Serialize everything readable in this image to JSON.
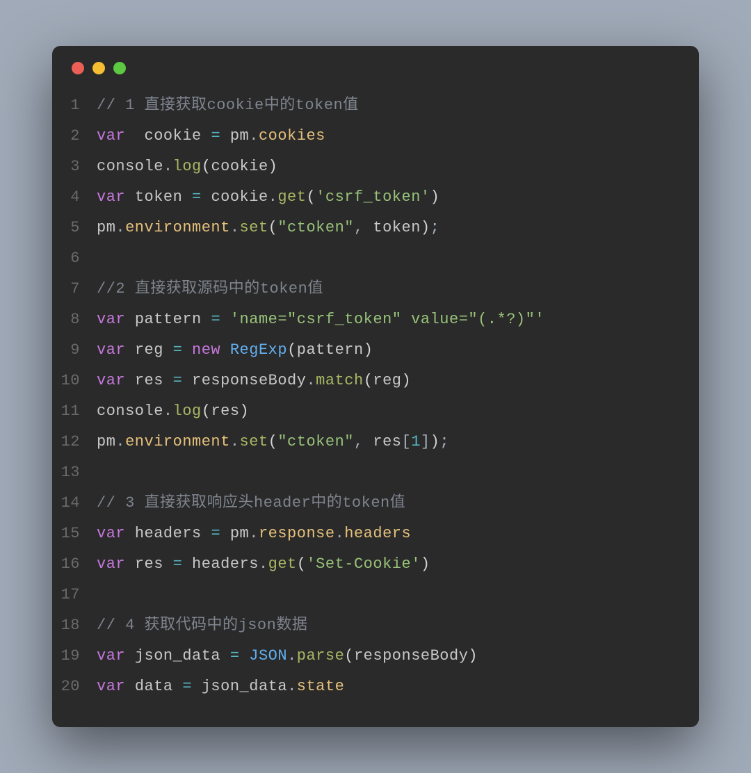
{
  "window": {
    "traffic_lights": {
      "red": "#ec5f56",
      "yellow": "#f5bd31",
      "green": "#5dc942"
    }
  },
  "code": {
    "lines": [
      {
        "n": "1",
        "tokens": [
          {
            "c": "comment",
            "t": "// 1 直接获取cookie中的token值"
          }
        ]
      },
      {
        "n": "2",
        "tokens": [
          {
            "c": "keyword",
            "t": "var"
          },
          {
            "c": "plain",
            "t": "  "
          },
          {
            "c": "ident",
            "t": "cookie"
          },
          {
            "c": "plain",
            "t": " "
          },
          {
            "c": "op",
            "t": "="
          },
          {
            "c": "plain",
            "t": " "
          },
          {
            "c": "ident",
            "t": "pm"
          },
          {
            "c": "punct",
            "t": "."
          },
          {
            "c": "prop",
            "t": "cookies"
          }
        ]
      },
      {
        "n": "3",
        "tokens": [
          {
            "c": "ident",
            "t": "console"
          },
          {
            "c": "punct",
            "t": "."
          },
          {
            "c": "method2",
            "t": "log"
          },
          {
            "c": "paren",
            "t": "("
          },
          {
            "c": "ident",
            "t": "cookie"
          },
          {
            "c": "paren",
            "t": ")"
          }
        ]
      },
      {
        "n": "4",
        "tokens": [
          {
            "c": "keyword",
            "t": "var"
          },
          {
            "c": "plain",
            "t": " "
          },
          {
            "c": "ident",
            "t": "token"
          },
          {
            "c": "plain",
            "t": " "
          },
          {
            "c": "op",
            "t": "="
          },
          {
            "c": "plain",
            "t": " "
          },
          {
            "c": "ident",
            "t": "cookie"
          },
          {
            "c": "punct",
            "t": "."
          },
          {
            "c": "method2",
            "t": "get"
          },
          {
            "c": "paren",
            "t": "("
          },
          {
            "c": "string",
            "t": "'csrf_token'"
          },
          {
            "c": "paren",
            "t": ")"
          }
        ]
      },
      {
        "n": "5",
        "tokens": [
          {
            "c": "ident",
            "t": "pm"
          },
          {
            "c": "punct",
            "t": "."
          },
          {
            "c": "prop",
            "t": "environment"
          },
          {
            "c": "punct",
            "t": "."
          },
          {
            "c": "method2",
            "t": "set"
          },
          {
            "c": "paren",
            "t": "("
          },
          {
            "c": "string",
            "t": "\"ctoken\""
          },
          {
            "c": "punct",
            "t": ", "
          },
          {
            "c": "ident",
            "t": "token"
          },
          {
            "c": "paren",
            "t": ")"
          },
          {
            "c": "punct",
            "t": ";"
          }
        ]
      },
      {
        "n": "6",
        "tokens": [
          {
            "c": "plain",
            "t": ""
          }
        ]
      },
      {
        "n": "7",
        "tokens": [
          {
            "c": "comment",
            "t": "//2 直接获取源码中的token值"
          }
        ]
      },
      {
        "n": "8",
        "tokens": [
          {
            "c": "keyword",
            "t": "var"
          },
          {
            "c": "plain",
            "t": " "
          },
          {
            "c": "ident",
            "t": "pattern"
          },
          {
            "c": "plain",
            "t": " "
          },
          {
            "c": "op",
            "t": "="
          },
          {
            "c": "plain",
            "t": " "
          },
          {
            "c": "string",
            "t": "'name=\"csrf_token\" value=\"(.*?)\"'"
          }
        ]
      },
      {
        "n": "9",
        "tokens": [
          {
            "c": "keyword",
            "t": "var"
          },
          {
            "c": "plain",
            "t": " "
          },
          {
            "c": "ident",
            "t": "reg"
          },
          {
            "c": "plain",
            "t": " "
          },
          {
            "c": "op",
            "t": "="
          },
          {
            "c": "plain",
            "t": " "
          },
          {
            "c": "keyword",
            "t": "new"
          },
          {
            "c": "plain",
            "t": " "
          },
          {
            "c": "type",
            "t": "RegExp"
          },
          {
            "c": "paren",
            "t": "("
          },
          {
            "c": "ident",
            "t": "pattern"
          },
          {
            "c": "paren",
            "t": ")"
          }
        ]
      },
      {
        "n": "10",
        "tokens": [
          {
            "c": "keyword",
            "t": "var"
          },
          {
            "c": "plain",
            "t": " "
          },
          {
            "c": "ident",
            "t": "res"
          },
          {
            "c": "plain",
            "t": " "
          },
          {
            "c": "op",
            "t": "="
          },
          {
            "c": "plain",
            "t": " "
          },
          {
            "c": "ident",
            "t": "responseBody"
          },
          {
            "c": "punct",
            "t": "."
          },
          {
            "c": "method2",
            "t": "match"
          },
          {
            "c": "paren",
            "t": "("
          },
          {
            "c": "ident",
            "t": "reg"
          },
          {
            "c": "paren",
            "t": ")"
          }
        ]
      },
      {
        "n": "11",
        "tokens": [
          {
            "c": "ident",
            "t": "console"
          },
          {
            "c": "punct",
            "t": "."
          },
          {
            "c": "method2",
            "t": "log"
          },
          {
            "c": "paren",
            "t": "("
          },
          {
            "c": "ident",
            "t": "res"
          },
          {
            "c": "paren",
            "t": ")"
          }
        ]
      },
      {
        "n": "12",
        "tokens": [
          {
            "c": "ident",
            "t": "pm"
          },
          {
            "c": "punct",
            "t": "."
          },
          {
            "c": "prop",
            "t": "environment"
          },
          {
            "c": "punct",
            "t": "."
          },
          {
            "c": "method2",
            "t": "set"
          },
          {
            "c": "paren",
            "t": "("
          },
          {
            "c": "string",
            "t": "\"ctoken\""
          },
          {
            "c": "punct",
            "t": ", "
          },
          {
            "c": "ident",
            "t": "res"
          },
          {
            "c": "punct",
            "t": "["
          },
          {
            "c": "number",
            "t": "1"
          },
          {
            "c": "punct",
            "t": "]"
          },
          {
            "c": "paren",
            "t": ")"
          },
          {
            "c": "punct",
            "t": ";"
          }
        ]
      },
      {
        "n": "13",
        "tokens": [
          {
            "c": "plain",
            "t": ""
          }
        ]
      },
      {
        "n": "14",
        "tokens": [
          {
            "c": "comment",
            "t": "// 3 直接获取响应头header中的token值"
          }
        ]
      },
      {
        "n": "15",
        "tokens": [
          {
            "c": "keyword",
            "t": "var"
          },
          {
            "c": "plain",
            "t": " "
          },
          {
            "c": "ident",
            "t": "headers"
          },
          {
            "c": "plain",
            "t": " "
          },
          {
            "c": "op",
            "t": "="
          },
          {
            "c": "plain",
            "t": " "
          },
          {
            "c": "ident",
            "t": "pm"
          },
          {
            "c": "punct",
            "t": "."
          },
          {
            "c": "prop",
            "t": "response"
          },
          {
            "c": "punct",
            "t": "."
          },
          {
            "c": "prop",
            "t": "headers"
          }
        ]
      },
      {
        "n": "16",
        "tokens": [
          {
            "c": "keyword",
            "t": "var"
          },
          {
            "c": "plain",
            "t": " "
          },
          {
            "c": "ident",
            "t": "res"
          },
          {
            "c": "plain",
            "t": " "
          },
          {
            "c": "op",
            "t": "="
          },
          {
            "c": "plain",
            "t": " "
          },
          {
            "c": "ident",
            "t": "headers"
          },
          {
            "c": "punct",
            "t": "."
          },
          {
            "c": "method2",
            "t": "get"
          },
          {
            "c": "paren",
            "t": "("
          },
          {
            "c": "string",
            "t": "'Set-Cookie'"
          },
          {
            "c": "paren",
            "t": ")"
          }
        ]
      },
      {
        "n": "17",
        "tokens": [
          {
            "c": "plain",
            "t": ""
          }
        ]
      },
      {
        "n": "18",
        "tokens": [
          {
            "c": "comment",
            "t": "// 4 获取代码中的json数据"
          }
        ]
      },
      {
        "n": "19",
        "tokens": [
          {
            "c": "keyword",
            "t": "var"
          },
          {
            "c": "plain",
            "t": " "
          },
          {
            "c": "ident",
            "t": "json_data"
          },
          {
            "c": "plain",
            "t": " "
          },
          {
            "c": "op",
            "t": "="
          },
          {
            "c": "plain",
            "t": " "
          },
          {
            "c": "type",
            "t": "JSON"
          },
          {
            "c": "punct",
            "t": "."
          },
          {
            "c": "method2",
            "t": "parse"
          },
          {
            "c": "paren",
            "t": "("
          },
          {
            "c": "ident",
            "t": "responseBody"
          },
          {
            "c": "paren",
            "t": ")"
          }
        ]
      },
      {
        "n": "20",
        "tokens": [
          {
            "c": "keyword",
            "t": "var"
          },
          {
            "c": "plain",
            "t": " "
          },
          {
            "c": "ident",
            "t": "data"
          },
          {
            "c": "plain",
            "t": " "
          },
          {
            "c": "op",
            "t": "="
          },
          {
            "c": "plain",
            "t": " "
          },
          {
            "c": "ident",
            "t": "json_data"
          },
          {
            "c": "punct",
            "t": "."
          },
          {
            "c": "prop",
            "t": "state"
          }
        ]
      }
    ]
  }
}
